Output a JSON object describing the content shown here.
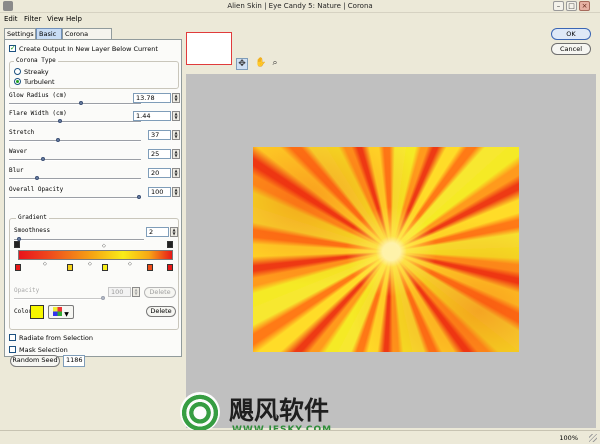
{
  "window": {
    "title": "Alien Skin | Eye Candy 5: Nature | Corona",
    "minimize": "–",
    "maximize": "□",
    "close": "×"
  },
  "menu": [
    "Edit",
    "Filter",
    "View",
    "Help"
  ],
  "tabs": [
    {
      "label": "Settings",
      "active": false
    },
    {
      "label": "Basic",
      "active": true
    },
    {
      "label": "Corona Offset",
      "active": false
    }
  ],
  "basic": {
    "create_output_label": "Create Output In New Layer Below Current",
    "create_output_checked": true,
    "corona_type": {
      "title": "Corona Type",
      "options": [
        {
          "label": "Streaky",
          "selected": false
        },
        {
          "label": "Turbulent",
          "selected": true
        }
      ]
    },
    "sliders": [
      {
        "label": "Glow Radius (cm)",
        "value": "13.78",
        "level": 0.55
      },
      {
        "label": "Flare Width (cm)",
        "value": "1.44",
        "level": 0.38
      },
      {
        "label": "Stretch",
        "value": "37",
        "level": 0.37
      },
      {
        "label": "Waver",
        "value": "25",
        "level": 0.25
      },
      {
        "label": "Blur",
        "value": "20",
        "level": 0.2
      },
      {
        "label": "Overall Opacity",
        "value": "100",
        "level": 1.0
      }
    ],
    "gradient": {
      "title": "Gradient",
      "smoothness_label": "Smoothness",
      "smoothness_value": "2",
      "smoothness_level": 0.02,
      "opacity_label": "Opacity",
      "opacity_value": "100",
      "opacity_delete": "Delete",
      "color_label": "Color",
      "color_swatch": "#f7f700",
      "color_delete": "Delete"
    },
    "radiate_label": "Radiate from Selection",
    "radiate_checked": false,
    "mask_label": "Mask Selection",
    "mask_checked": false,
    "random_seed_label": "Random Seed",
    "random_seed_value": "1186"
  },
  "preview_tools": [
    {
      "icon": "bucket-move-icon",
      "glyph": "✥",
      "active": true
    },
    {
      "icon": "hand-icon",
      "glyph": "✋",
      "active": false
    },
    {
      "icon": "zoom-icon",
      "glyph": "⌕",
      "active": false
    }
  ],
  "actions": {
    "ok": "OK",
    "cancel": "Cancel"
  },
  "watermark": {
    "text_cn": "飓风软件",
    "url": "WWW.JFSKY.COM"
  },
  "status": {
    "zoom": "100%"
  }
}
